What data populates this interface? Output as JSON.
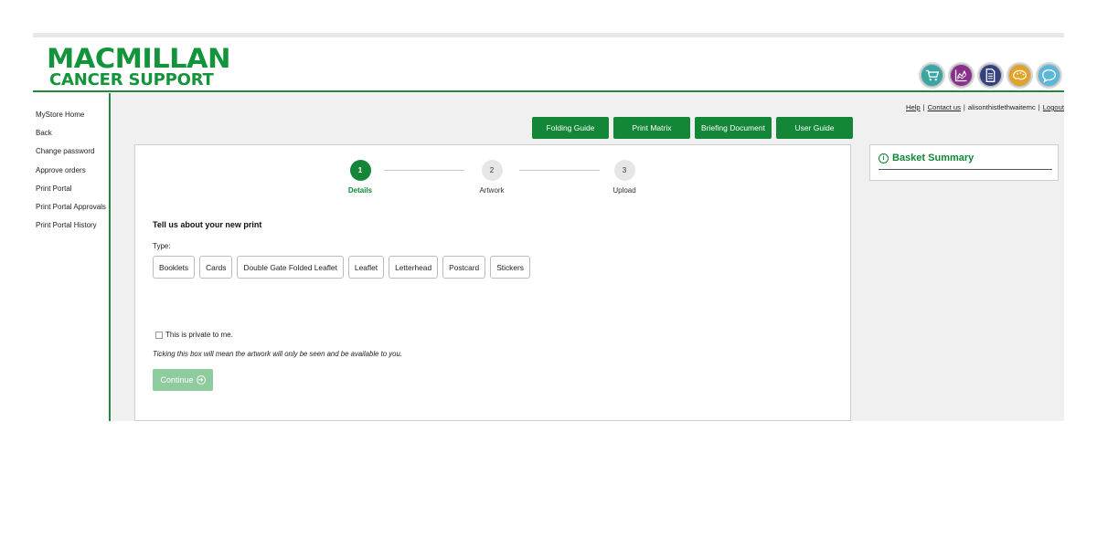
{
  "brand": {
    "line1": "MACMILLAN",
    "line2": "CANCER SUPPORT",
    "color": "#14943a"
  },
  "header_icons": [
    {
      "name": "basket-icon",
      "color": "#3aa6a4"
    },
    {
      "name": "chart-icon",
      "color": "#8b2f8c"
    },
    {
      "name": "document-icon",
      "color": "#34417f"
    },
    {
      "name": "palette-icon",
      "color": "#e2a227"
    },
    {
      "name": "chat-icon",
      "color": "#5bb7da"
    }
  ],
  "sidebar": {
    "items": [
      {
        "label": "MyStore Home"
      },
      {
        "label": "Back"
      },
      {
        "label": "Change password"
      },
      {
        "label": "Approve orders"
      },
      {
        "label": "Print Portal"
      },
      {
        "label": "Print Portal Approvals"
      },
      {
        "label": "Print Portal History"
      }
    ]
  },
  "toplinks": {
    "help": "Help",
    "contact": "Contact us",
    "user": "alisonthistlethwaitemc",
    "logout": "Logout",
    "sep": "|"
  },
  "guides": [
    {
      "label": "Folding Guide"
    },
    {
      "label": "Print Matrix"
    },
    {
      "label": "Briefing Document"
    },
    {
      "label": "User Guide"
    }
  ],
  "steps": [
    {
      "num": "1",
      "label": "Details",
      "active": true
    },
    {
      "num": "2",
      "label": "Artwork",
      "active": false
    },
    {
      "num": "3",
      "label": "Upload",
      "active": false
    }
  ],
  "form": {
    "heading": "Tell us about your new print",
    "type_label": "Type:",
    "types": [
      "Booklets",
      "Cards",
      "Double Gate Folded Leaflet",
      "Leaflet",
      "Letterhead",
      "Postcard",
      "Stickers"
    ],
    "private_label": "This is private to me.",
    "private_checked": false,
    "note": "Ticking this box will mean the artwork will only be seen and be available to you.",
    "continue_label": "Continue"
  },
  "basket": {
    "title": "Basket Summary"
  },
  "colors": {
    "accent": "#138737",
    "disabled_button": "#8ecb9f",
    "panel_bg": "#f0f0f0"
  }
}
